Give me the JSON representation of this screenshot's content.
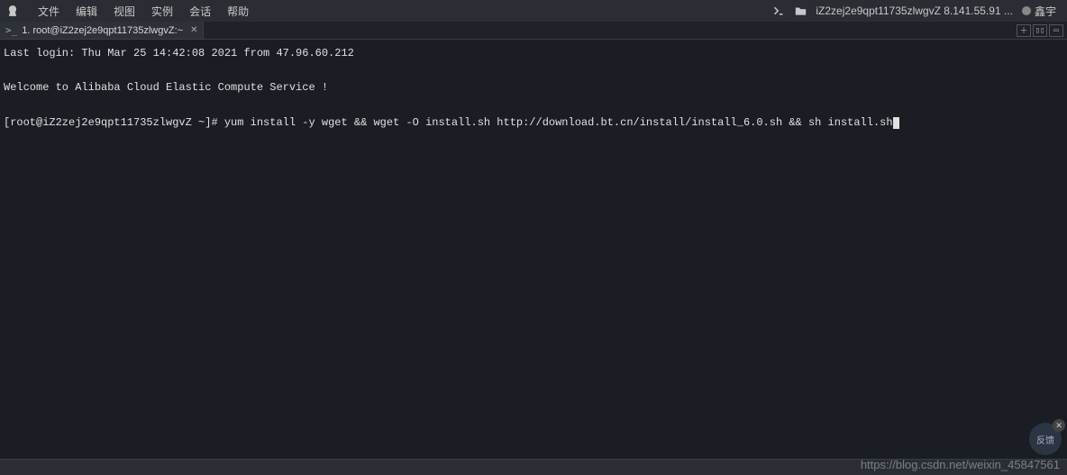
{
  "menubar": {
    "items": [
      "文件",
      "编辑",
      "视图",
      "实例",
      "会话",
      "帮助"
    ],
    "server_label": "iZ2zej2e9qpt11735zlwgvZ 8.141.55.91 ...",
    "user_label": "鑫宇"
  },
  "tab": {
    "label": "1. root@iZ2zej2e9qpt11735zlwgvZ:~"
  },
  "terminal": {
    "last_login": "Last login: Thu Mar 25 14:42:08 2021 from 47.96.60.212",
    "welcome": "Welcome to Alibaba Cloud Elastic Compute Service !",
    "prompt": "[root@iZ2zej2e9qpt11735zlwgvZ ~]# ",
    "command": "yum install -y wget && wget -O install.sh http://download.bt.cn/install/install_6.0.sh && sh install.sh"
  },
  "feedback": {
    "label": "反馈"
  },
  "watermark": "https://blog.csdn.net/weixin_45847561"
}
